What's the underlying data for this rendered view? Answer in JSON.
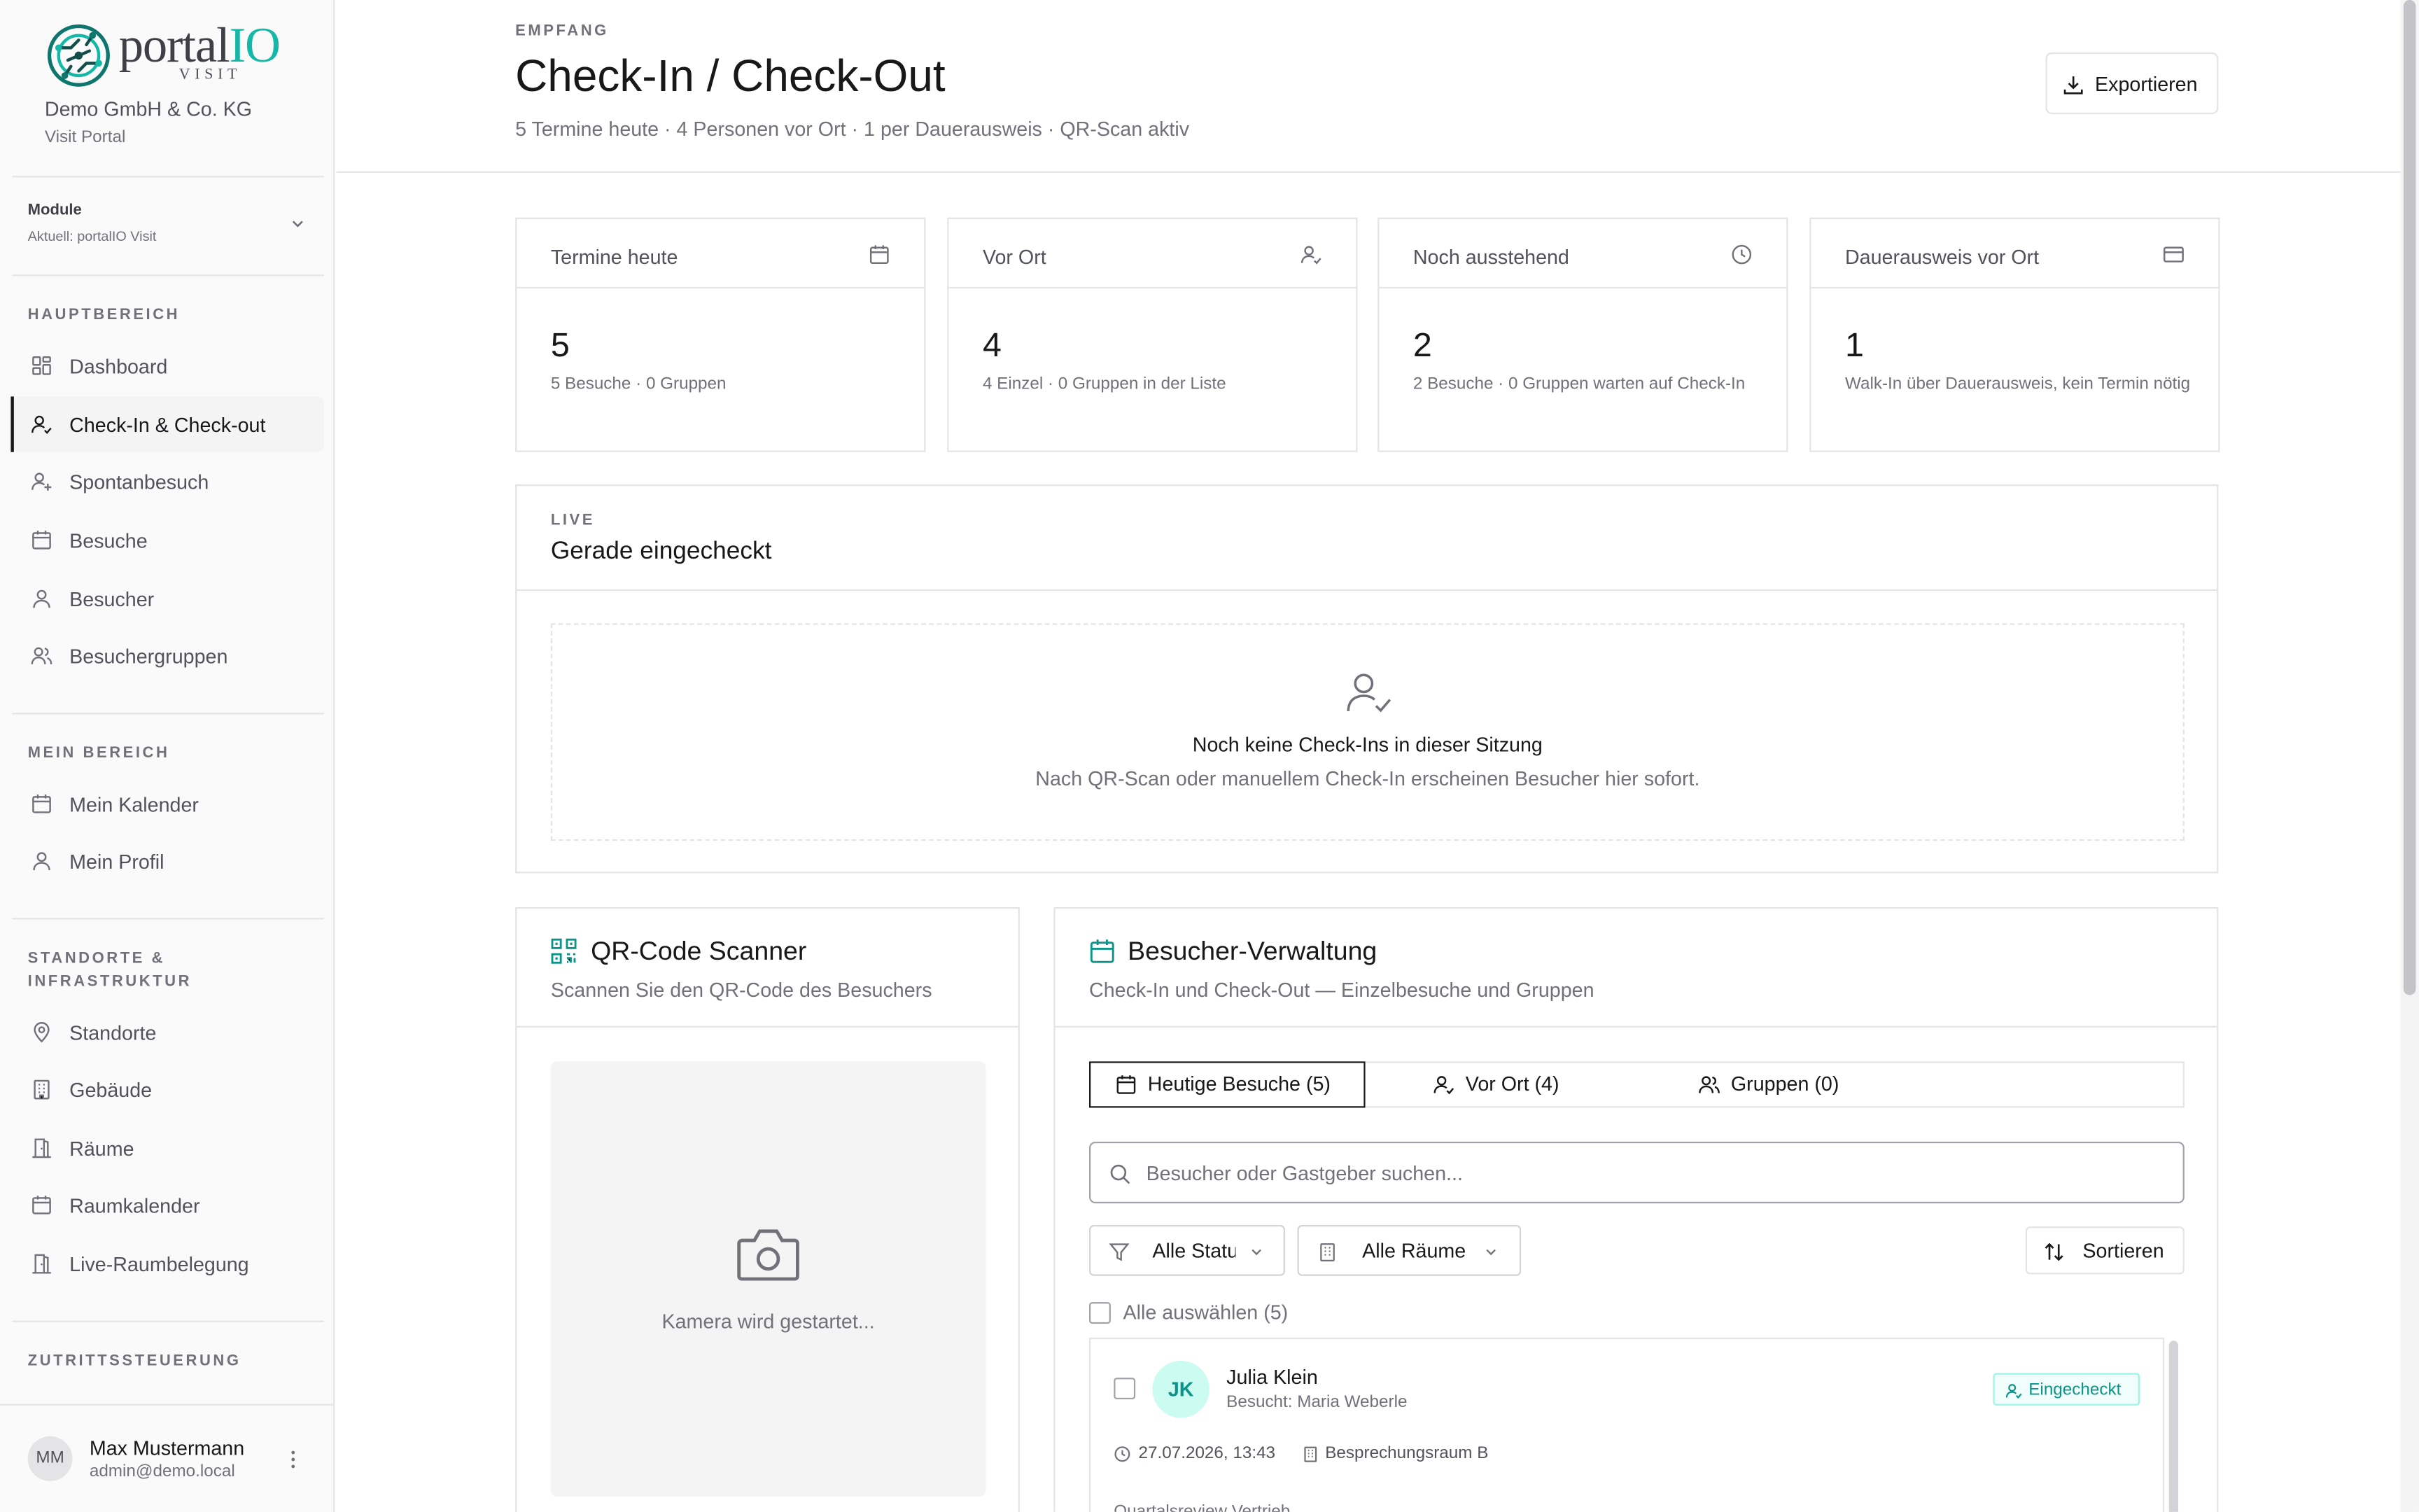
{
  "app": {
    "logo_word_main": "portal",
    "logo_word_accent": "IO",
    "logo_sub": "VISIT",
    "org_name": "Demo GmbH & Co. KG",
    "org_sub": "Visit Portal",
    "accent_color": "#14b8a6"
  },
  "sidebar": {
    "module": {
      "label": "Module",
      "current": "Aktuell: portalIO Visit"
    },
    "sections": [
      {
        "label": "HAUPTBEREICH",
        "items": [
          {
            "label": "Dashboard",
            "icon": "grid-icon",
            "active": false
          },
          {
            "label": "Check-In & Check-out",
            "icon": "user-check-icon",
            "active": true
          },
          {
            "label": "Spontanbesuch",
            "icon": "user-plus-icon",
            "active": false
          },
          {
            "label": "Besuche",
            "icon": "calendar-icon",
            "active": false
          },
          {
            "label": "Besucher",
            "icon": "user-icon",
            "active": false
          },
          {
            "label": "Besuchergruppen",
            "icon": "users-icon",
            "active": false
          }
        ]
      },
      {
        "label": "MEIN BEREICH",
        "items": [
          {
            "label": "Mein Kalender",
            "icon": "calendar-icon",
            "active": false
          },
          {
            "label": "Mein Profil",
            "icon": "user-icon",
            "active": false
          }
        ]
      },
      {
        "label": "STANDORTE & INFRASTRUKTUR",
        "items": [
          {
            "label": "Standorte",
            "icon": "map-pin-icon",
            "active": false
          },
          {
            "label": "Gebäude",
            "icon": "building-icon",
            "active": false
          },
          {
            "label": "Räume",
            "icon": "door-icon",
            "active": false
          },
          {
            "label": "Raumkalender",
            "icon": "calendar-icon",
            "active": false
          },
          {
            "label": "Live-Raumbelegung",
            "icon": "door-icon",
            "active": false
          }
        ]
      },
      {
        "label": "ZUTRITTSSTEUERUNG",
        "items": []
      }
    ],
    "user": {
      "initials": "MM",
      "name": "Max Mustermann",
      "email": "admin@demo.local"
    }
  },
  "header": {
    "eyebrow": "EMPFANG",
    "title": "Check-In / Check-Out",
    "subtitle": "5 Termine heute · 4 Personen vor Ort · 1 per Dauerausweis · QR-Scan aktiv",
    "export_label": "Exportieren"
  },
  "stats": [
    {
      "label": "Termine heute",
      "icon": "calendar-icon",
      "value": "5",
      "desc": "5 Besuche · 0 Gruppen"
    },
    {
      "label": "Vor Ort",
      "icon": "user-check-icon",
      "value": "4",
      "desc": "4 Einzel · 0 Gruppen in der Liste"
    },
    {
      "label": "Noch ausstehend",
      "icon": "clock-icon",
      "value": "2",
      "desc": "2 Besuche · 0 Gruppen warten auf Check-In"
    },
    {
      "label": "Dauerausweis vor Ort",
      "icon": "card-icon",
      "value": "1",
      "desc": "Walk-In über Dauerausweis, kein Termin nötig"
    }
  ],
  "live": {
    "eyebrow": "LIVE",
    "title": "Gerade eingecheckt",
    "empty_title": "Noch keine Check-Ins in dieser Sitzung",
    "empty_text": "Nach QR-Scan oder manuellem Check-In erscheinen Besucher hier sofort."
  },
  "qr": {
    "title": "QR-Code Scanner",
    "subtitle": "Scannen Sie den QR-Code des Besuchers",
    "camera_status": "Kamera wird gestartet..."
  },
  "visitors": {
    "title": "Besucher-Verwaltung",
    "subtitle": "Check-In und Check-Out — Einzelbesuche und Gruppen",
    "tabs": [
      {
        "label": "Heutige Besuche (5)",
        "icon": "calendar-icon",
        "active": true
      },
      {
        "label": "Vor Ort (4)",
        "icon": "user-check-icon",
        "active": false
      },
      {
        "label": "Gruppen (0)",
        "icon": "users-icon",
        "active": false
      }
    ],
    "search_placeholder": "Besucher oder Gastgeber suchen...",
    "search_value": "",
    "status_filter": "Alle Status",
    "room_filter": "Alle Räume",
    "sort_label": "Sortieren",
    "select_all": "Alle auswählen (5)",
    "rows": [
      {
        "initials": "JK",
        "name": "Julia Klein",
        "host": "Besucht: Maria Weberle",
        "status": "Eingecheckt",
        "datetime": "27.07.2026, 13:43",
        "room": "Besprechungsraum B",
        "note": "Quartalsreview Vertrieb"
      }
    ]
  }
}
